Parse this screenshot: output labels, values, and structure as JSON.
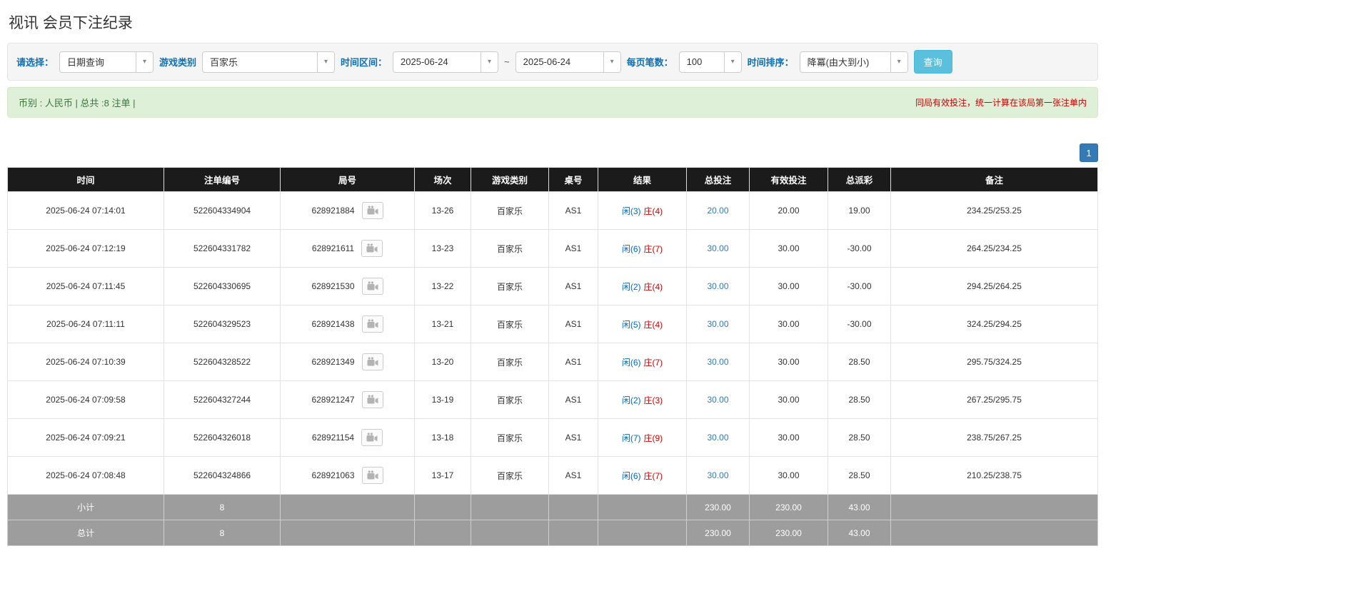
{
  "page": {
    "title": "视讯 会员下注纪录"
  },
  "filters": {
    "select_label": "请选择：",
    "select_value": "日期查询",
    "game_type_label": "游戏类别",
    "game_type_value": "百家乐",
    "date_range_label": "时间区间：",
    "date_from": "2025-06-24",
    "date_separator": "~",
    "date_to": "2025-06-24",
    "page_size_label": "每页笔数：",
    "page_size_value": "100",
    "sort_label": "时间排序：",
    "sort_value": "降冪(由大到小)",
    "search_button": "查询"
  },
  "notice": {
    "left": "币别 : 人民币 | 总共 :8 注单 |",
    "right": "同局有效投注，统一计算在该局第一张注单内"
  },
  "pagination": {
    "pages": [
      "1"
    ]
  },
  "icons": {
    "caret_down": "▾",
    "video_replay": "film-camera"
  },
  "colors": {
    "accent_blue": "#337ab7",
    "info_button": "#5bc0de",
    "filter_label": "#0e6eb8",
    "result_player": "#0066cc",
    "result_banker": "#cc0000",
    "negative": "#ee0000",
    "notice_bg": "#dff0d8",
    "notice_text": "#3c763d",
    "warning_text": "#cc0000",
    "header_bg": "#1b1b1b",
    "footer_bg": "#9d9d9d"
  },
  "table": {
    "headers": [
      "时间",
      "注单编号",
      "局号",
      "场次",
      "游戏类别",
      "桌号",
      "结果",
      "总投注",
      "有效投注",
      "总派彩",
      "备注"
    ],
    "rows": [
      {
        "time": "2025-06-24 07:14:01",
        "bet_id": "522604334904",
        "round_id": "628921884",
        "session": "13-26",
        "game": "百家乐",
        "table_no": "AS1",
        "result_player": "闲(3)",
        "result_banker": "庄(4)",
        "total_bet": "20.00",
        "valid_bet": "20.00",
        "payout": "19.00",
        "remark": "234.25/253.25"
      },
      {
        "time": "2025-06-24 07:12:19",
        "bet_id": "522604331782",
        "round_id": "628921611",
        "session": "13-23",
        "game": "百家乐",
        "table_no": "AS1",
        "result_player": "闲(6)",
        "result_banker": "庄(7)",
        "total_bet": "30.00",
        "valid_bet": "30.00",
        "payout": "-30.00",
        "remark": "264.25/234.25"
      },
      {
        "time": "2025-06-24 07:11:45",
        "bet_id": "522604330695",
        "round_id": "628921530",
        "session": "13-22",
        "game": "百家乐",
        "table_no": "AS1",
        "result_player": "闲(2)",
        "result_banker": "庄(4)",
        "total_bet": "30.00",
        "valid_bet": "30.00",
        "payout": "-30.00",
        "remark": "294.25/264.25"
      },
      {
        "time": "2025-06-24 07:11:11",
        "bet_id": "522604329523",
        "round_id": "628921438",
        "session": "13-21",
        "game": "百家乐",
        "table_no": "AS1",
        "result_player": "闲(5)",
        "result_banker": "庄(4)",
        "total_bet": "30.00",
        "valid_bet": "30.00",
        "payout": "-30.00",
        "remark": "324.25/294.25"
      },
      {
        "time": "2025-06-24 07:10:39",
        "bet_id": "522604328522",
        "round_id": "628921349",
        "session": "13-20",
        "game": "百家乐",
        "table_no": "AS1",
        "result_player": "闲(6)",
        "result_banker": "庄(7)",
        "total_bet": "30.00",
        "valid_bet": "30.00",
        "payout": "28.50",
        "remark": "295.75/324.25"
      },
      {
        "time": "2025-06-24 07:09:58",
        "bet_id": "522604327244",
        "round_id": "628921247",
        "session": "13-19",
        "game": "百家乐",
        "table_no": "AS1",
        "result_player": "闲(2)",
        "result_banker": "庄(3)",
        "total_bet": "30.00",
        "valid_bet": "30.00",
        "payout": "28.50",
        "remark": "267.25/295.75"
      },
      {
        "time": "2025-06-24 07:09:21",
        "bet_id": "522604326018",
        "round_id": "628921154",
        "session": "13-18",
        "game": "百家乐",
        "table_no": "AS1",
        "result_player": "闲(7)",
        "result_banker": "庄(9)",
        "total_bet": "30.00",
        "valid_bet": "30.00",
        "payout": "28.50",
        "remark": "238.75/267.25"
      },
      {
        "time": "2025-06-24 07:08:48",
        "bet_id": "522604324866",
        "round_id": "628921063",
        "session": "13-17",
        "game": "百家乐",
        "table_no": "AS1",
        "result_player": "闲(6)",
        "result_banker": "庄(7)",
        "total_bet": "30.00",
        "valid_bet": "30.00",
        "payout": "28.50",
        "remark": "210.25/238.75"
      }
    ],
    "footer": [
      {
        "label": "小计",
        "count": "8",
        "total_bet": "230.00",
        "valid_bet": "230.00",
        "payout": "43.00"
      },
      {
        "label": "总计",
        "count": "8",
        "total_bet": "230.00",
        "valid_bet": "230.00",
        "payout": "43.00"
      }
    ]
  }
}
